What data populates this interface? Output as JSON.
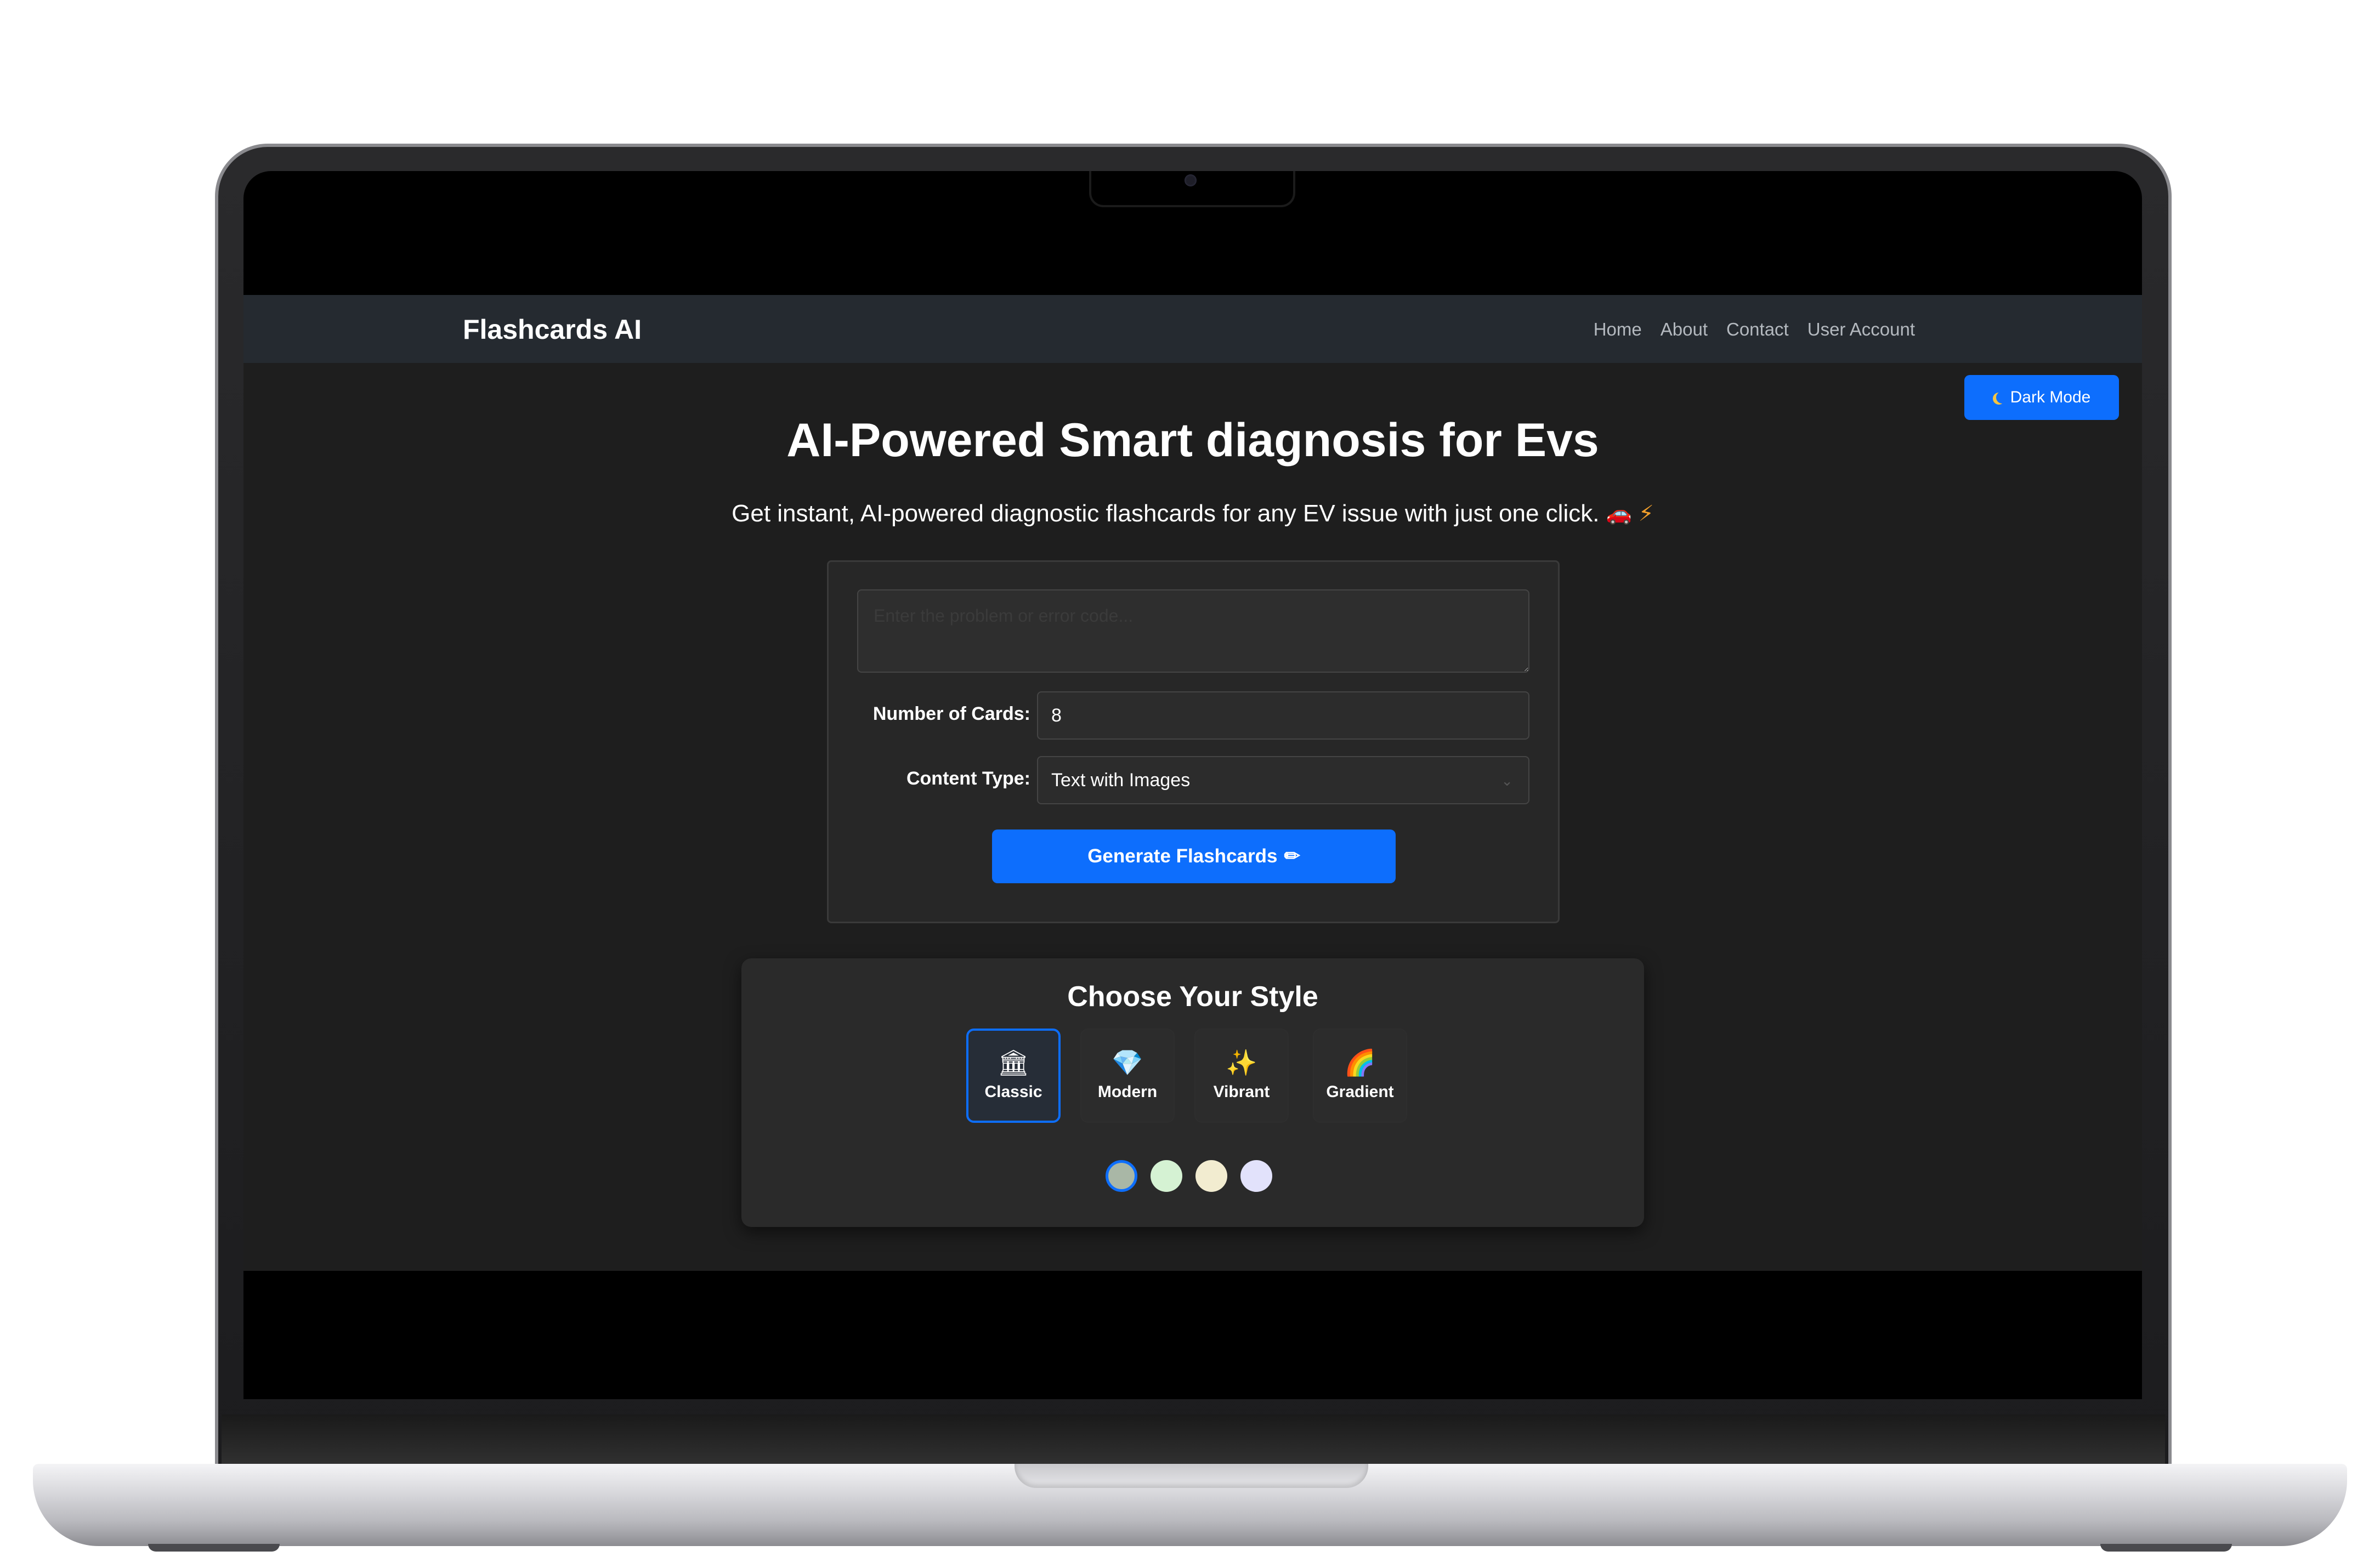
{
  "navbar": {
    "brand": "Flashcards AI",
    "links": [
      "Home",
      "About",
      "Contact",
      "User Account"
    ]
  },
  "dark_mode_button": {
    "label": "Dark Mode",
    "icon": "moon-icon"
  },
  "hero": {
    "title": "AI-Powered Smart diagnosis for Evs",
    "subtitle": "Get instant, AI-powered diagnostic flashcards for any EV issue with just one click.",
    "subtitle_icons": [
      "car-icon",
      "lightning-icon"
    ]
  },
  "form": {
    "problem_placeholder": "Enter the problem or error code...",
    "cards_label": "Number of Cards:",
    "cards_value": "8",
    "content_type_label": "Content Type:",
    "content_type_value": "Text with Images",
    "generate_label": "Generate Flashcards",
    "generate_icon": "pencil-icon"
  },
  "style_picker": {
    "title": "Choose Your Style",
    "options": [
      {
        "label": "Classic",
        "icon": "classical-building-icon",
        "selected": true
      },
      {
        "label": "Modern",
        "icon": "gem-icon",
        "selected": false
      },
      {
        "label": "Vibrant",
        "icon": "sparkles-icon",
        "selected": false
      },
      {
        "label": "Gradient",
        "icon": "rainbow-icon",
        "selected": false
      }
    ],
    "swatches": [
      {
        "color": "#a9b7a6",
        "selected": true
      },
      {
        "color": "#d5f2d3",
        "selected": false
      },
      {
        "color": "#f2ecd0",
        "selected": false
      },
      {
        "color": "#e2e2fb",
        "selected": false
      }
    ]
  },
  "colors": {
    "accent": "#0d6efd",
    "navbar_bg": "#252a30",
    "page_bg": "#1e1e1e",
    "card_bg": "#272727"
  }
}
